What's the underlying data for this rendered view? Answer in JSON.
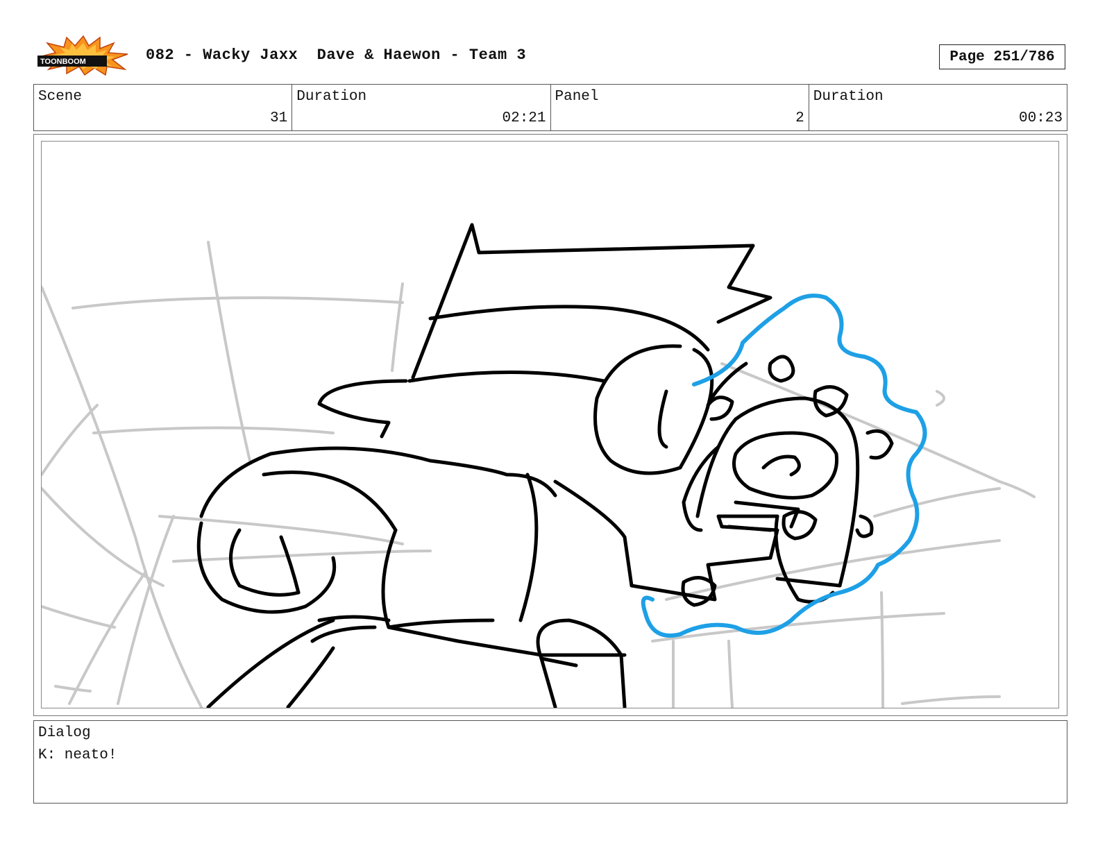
{
  "header": {
    "logo_text": "TOONBOOM",
    "title": "082 - Wacky Jaxx  Dave & Haewon - Team 3",
    "page": "Page 251/786"
  },
  "info": [
    {
      "label": "Scene",
      "value": "31"
    },
    {
      "label": "Duration",
      "value": "02:21"
    },
    {
      "label": "Panel",
      "value": "2"
    },
    {
      "label": "Duration",
      "value": "00:23"
    }
  ],
  "dialog": {
    "label": "Dialog",
    "text": "K: neato!"
  },
  "colors": {
    "sketch_line": "#000000",
    "background_line": "#c8c8c8",
    "effect_outline": "#1ea0e6",
    "logo_burst": "#f7941d"
  }
}
